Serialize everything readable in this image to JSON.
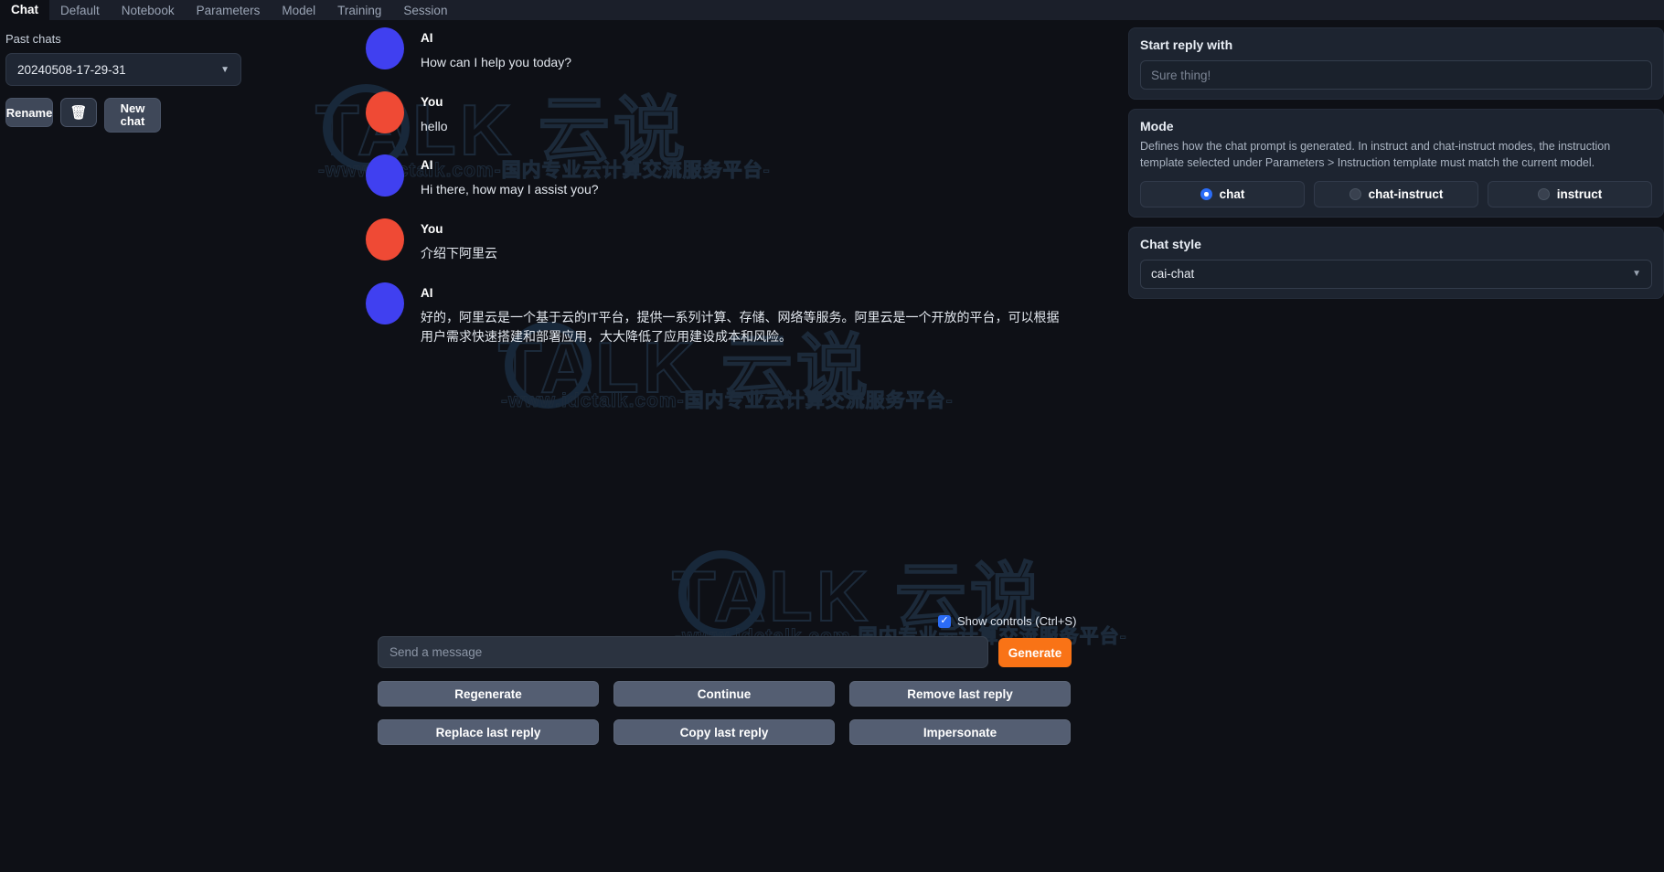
{
  "tabs": [
    {
      "label": "Chat",
      "active": true
    },
    {
      "label": "Default",
      "active": false
    },
    {
      "label": "Notebook",
      "active": false
    },
    {
      "label": "Parameters",
      "active": false
    },
    {
      "label": "Model",
      "active": false
    },
    {
      "label": "Training",
      "active": false
    },
    {
      "label": "Session",
      "active": false
    }
  ],
  "sidebar": {
    "past_chats_label": "Past chats",
    "selected_chat": "20240508-17-29-31",
    "caret": "▼",
    "rename_label": "Rename",
    "delete_icon": "🗑",
    "new_chat_label": "New chat"
  },
  "chat": {
    "messages": [
      {
        "who": "AI",
        "role": "ai",
        "text": "How can I help you today?"
      },
      {
        "who": "You",
        "role": "you",
        "text": "hello"
      },
      {
        "who": "AI",
        "role": "ai",
        "text": "Hi there, how may I assist you?"
      },
      {
        "who": "You",
        "role": "you",
        "text": "介绍下阿里云"
      },
      {
        "who": "AI",
        "role": "ai",
        "text": "好的，阿里云是一个基于云的IT平台，提供一系列计算、存储、网络等服务。阿里云是一个开放的平台，可以根据用户需求快速搭建和部署应用，大大降低了应用建设成本和风险。"
      }
    ]
  },
  "controls": {
    "show_controls_label": "Show controls (Ctrl+S)",
    "show_controls_checked": true,
    "check_glyph": "✓",
    "send_placeholder": "Send a message",
    "generate_label": "Generate",
    "actions": [
      "Regenerate",
      "Continue",
      "Remove last reply",
      "Replace last reply",
      "Copy last reply",
      "Impersonate"
    ]
  },
  "right": {
    "start_reply": {
      "title": "Start reply with",
      "placeholder": "Sure thing!",
      "value": ""
    },
    "mode": {
      "title": "Mode",
      "description": "Defines how the chat prompt is generated. In instruct and chat-instruct modes, the instruction template selected under Parameters > Instruction template must match the current model.",
      "options": [
        {
          "label": "chat",
          "selected": true
        },
        {
          "label": "chat-instruct",
          "selected": false
        },
        {
          "label": "instruct",
          "selected": false
        }
      ]
    },
    "chat_style": {
      "title": "Chat style",
      "value": "cai-chat",
      "caret": "▼"
    }
  },
  "watermark": {
    "logo": "TALK 云说",
    "sub": "-www.idctalk.com-国内专业云计算交流服务平台-"
  },
  "colors": {
    "accent_blue": "#2b6cf6",
    "avatar_ai": "#4040f0",
    "avatar_you": "#ef4a35",
    "generate": "#f97316",
    "background": "#0e1016"
  }
}
